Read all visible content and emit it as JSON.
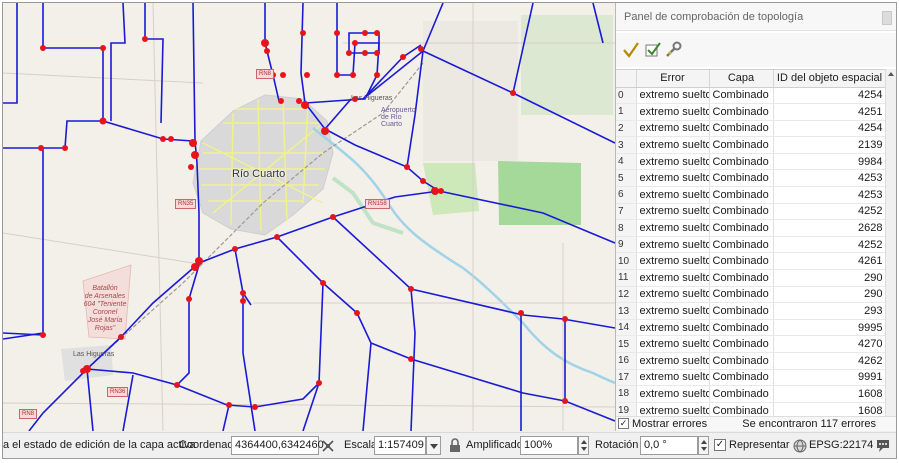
{
  "map": {
    "city_label": "Río Cuarto",
    "airport_label": "Aeropuerto de Río Cuarto",
    "place_label_lines": [
      "Batallón",
      "de Arsenales",
      "604 \"Teniente",
      "Coronel",
      "José María",
      "Rojas\""
    ],
    "town_labels": [
      "Las Higueras",
      "Las Higueras"
    ],
    "route_shields": [
      "RN8",
      "RN35",
      "RN158",
      "RN8",
      "RN36"
    ],
    "colors": {
      "road": "#1a1ad6",
      "node": "#e8141c",
      "urban": "#d9d9d9",
      "green": "#cfe8c0",
      "field": "#a5d99a",
      "street": "#f2f28a"
    }
  },
  "panel": {
    "title": "Panel de comprobación de topología",
    "toolbar": [
      {
        "name": "validate-all-icon",
        "glyph": "✔"
      },
      {
        "name": "validate-extent-icon",
        "glyph": "☑"
      },
      {
        "name": "configure-rules-icon",
        "glyph": "🔧"
      }
    ],
    "columns": [
      "",
      "Error",
      "Capa",
      "ID del objeto espacial"
    ],
    "rows": [
      {
        "idx": "0",
        "error": "extremo suelto",
        "layer": "Combinado",
        "id": "4254"
      },
      {
        "idx": "1",
        "error": "extremo suelto",
        "layer": "Combinado",
        "id": "4251"
      },
      {
        "idx": "2",
        "error": "extremo suelto",
        "layer": "Combinado",
        "id": "4254"
      },
      {
        "idx": "3",
        "error": "extremo suelto",
        "layer": "Combinado",
        "id": "2139"
      },
      {
        "idx": "4",
        "error": "extremo suelto",
        "layer": "Combinado",
        "id": "9984"
      },
      {
        "idx": "5",
        "error": "extremo suelto",
        "layer": "Combinado",
        "id": "4253"
      },
      {
        "idx": "6",
        "error": "extremo suelto",
        "layer": "Combinado",
        "id": "4253"
      },
      {
        "idx": "7",
        "error": "extremo suelto",
        "layer": "Combinado",
        "id": "4252"
      },
      {
        "idx": "8",
        "error": "extremo suelto",
        "layer": "Combinado",
        "id": "2628"
      },
      {
        "idx": "9",
        "error": "extremo suelto",
        "layer": "Combinado",
        "id": "4252"
      },
      {
        "idx": "10",
        "error": "extremo suelto",
        "layer": "Combinado",
        "id": "4261"
      },
      {
        "idx": "11",
        "error": "extremo suelto",
        "layer": "Combinado",
        "id": "290"
      },
      {
        "idx": "12",
        "error": "extremo suelto",
        "layer": "Combinado",
        "id": "290"
      },
      {
        "idx": "13",
        "error": "extremo suelto",
        "layer": "Combinado",
        "id": "293"
      },
      {
        "idx": "14",
        "error": "extremo suelto",
        "layer": "Combinado",
        "id": "9995"
      },
      {
        "idx": "15",
        "error": "extremo suelto",
        "layer": "Combinado",
        "id": "4270"
      },
      {
        "idx": "16",
        "error": "extremo suelto",
        "layer": "Combinado",
        "id": "4262"
      },
      {
        "idx": "17",
        "error": "extremo suelto",
        "layer": "Combinado",
        "id": "9991"
      },
      {
        "idx": "18",
        "error": "extremo suelto",
        "layer": "Combinado",
        "id": "1608"
      },
      {
        "idx": "19",
        "error": "extremo suelto",
        "layer": "Combinado",
        "id": "1608"
      }
    ],
    "show_errors_label": "Mostrar errores",
    "show_errors_checked": true,
    "errors_found": "Se encontraron 117 errores"
  },
  "statusbar": {
    "message": "a el estado de edición de la capa activa",
    "coord_label": "Coordenada",
    "coord_value": "4364400,6342460",
    "scale_label": "Escala",
    "scale_value": "1:157409",
    "magnifier_label": "Amplificador",
    "magnifier_value": "100%",
    "rotation_label": "Rotación",
    "rotation_value": "0,0 °",
    "render_label": "Representar",
    "render_checked": true,
    "crs_label": "EPSG:22174"
  }
}
